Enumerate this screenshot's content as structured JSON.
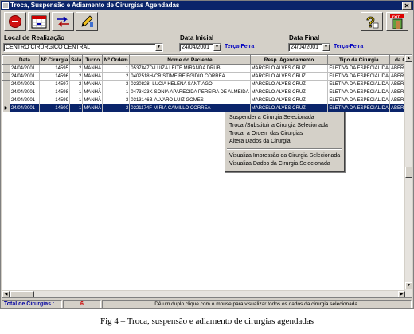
{
  "window": {
    "title": "Troca, Suspensão e Adiamento de Cirurgias Agendadas",
    "close_glyph": "✕"
  },
  "toolbar": {
    "buttons": [
      {
        "icon": "stop-circle-icon"
      },
      {
        "icon": "calendar-grid-icon"
      },
      {
        "icon": "swap-arrows-icon"
      },
      {
        "icon": "edit-pencil-icon"
      },
      {
        "icon": "help-question-icon"
      },
      {
        "icon": "exit-door-icon",
        "text": "EXIT"
      }
    ]
  },
  "filters": {
    "local_label": "Local de Realização",
    "local_value": "CENTRO CIRÚRGICO CENTRAL",
    "data_inicial_label": "Data Inicial",
    "data_inicial_value": "24/04/2001",
    "data_inicial_weekday": "Terça-Feira",
    "data_final_label": "Data Final",
    "data_final_value": "24/04/2001",
    "data_final_weekday": "Terça-Feira"
  },
  "table": {
    "columns": [
      "Data",
      "Nº Cirurgia",
      "Sala",
      "Turno",
      "Nº Ordem",
      "Nome do Paciente",
      "Resp. Agendamento",
      "Tipo da Cirurgia",
      "da C"
    ],
    "rows": [
      [
        "24/04/2001",
        "14595",
        "2",
        "MANHÃ",
        "1",
        "0537847D-LUIZA LEITE MIRANDA DRUBI",
        "MARCELO ALVES CRUZ",
        "ELETIVA DA ESPECIALIDA",
        "ABER"
      ],
      [
        "24/04/2001",
        "14596",
        "2",
        "MANHÃ",
        "2",
        "0402518H-CRISTIMEIRE EGIDIO CORREA",
        "MARCELO ALVES CRUZ",
        "ELETIVA DA ESPECIALIDA",
        "ABER"
      ],
      [
        "24/04/2001",
        "14597",
        "2",
        "MANHÃ",
        "3",
        "0230828I-LUCIA HELENA SANTIAGO",
        "MARCELO ALVES CRUZ",
        "ELETIVA DA ESPECIALIDA",
        "ABER"
      ],
      [
        "24/04/2001",
        "14598",
        "1",
        "MANHÃ",
        "1",
        "0473423K-SONIA APARECIDA PEREIRA DE ALMEIDA",
        "MARCELO ALVES CRUZ",
        "ELETIVA DA ESPECIALIDA",
        "ABER"
      ],
      [
        "24/04/2001",
        "14599",
        "1",
        "MANHÃ",
        "3",
        "0313146B-ALVARO LUIZ GOMES",
        "MARCELO ALVES CRUZ",
        "ELETIVA DA ESPECIALIDA",
        "ABER"
      ],
      [
        "24/04/2001",
        "14600",
        "1",
        "MANHÃ",
        "2",
        "0221174F-MIRIA CAMILLO CORREA",
        "MARCELO ALVES CRUZ",
        "ELETIVA DA ESPECIALIDA",
        "ABER"
      ]
    ],
    "selected_row_index": 5,
    "row_indicator": "▶"
  },
  "context_menu": {
    "group1": [
      "Suspender a Cirurgia Selecionada",
      "Trocar/Substituir a Cirurgia Selecionada",
      "Trocar a Ordem das Cirurgias",
      "Altera Dados da Cirurgia"
    ],
    "group2": [
      "Visualiza Impressão da Cirurgia Selecionada",
      "Visualiza Dados da Cirurgia Selecionada"
    ]
  },
  "status": {
    "total_label": "Total de Cirurgias :",
    "total_value": "6",
    "hint": "Dê um duplo clique com o mouse para visualizar todos os dados da cirurgia selecionada."
  },
  "caption": "Fig   4 – Troca, suspensão e adiamento de cirurgias agendadas",
  "colors": {
    "title_bar": "#0a246a",
    "selection": "#0a246a",
    "weekday_text": "#0000c0",
    "total_text": "#cc0000",
    "status_label_text": "#0000a0"
  }
}
